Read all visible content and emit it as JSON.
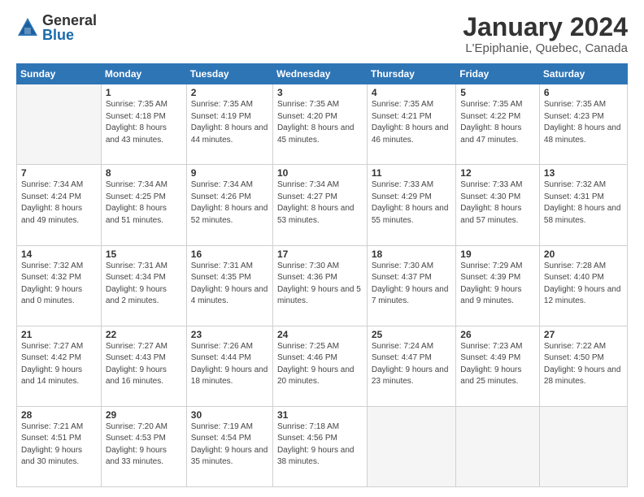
{
  "header": {
    "logo_general": "General",
    "logo_blue": "Blue",
    "title": "January 2024",
    "subtitle": "L'Epiphanie, Quebec, Canada"
  },
  "days": [
    "Sunday",
    "Monday",
    "Tuesday",
    "Wednesday",
    "Thursday",
    "Friday",
    "Saturday"
  ],
  "weeks": [
    [
      {
        "num": "",
        "sunrise": "",
        "sunset": "",
        "daylight": ""
      },
      {
        "num": "1",
        "sunrise": "Sunrise: 7:35 AM",
        "sunset": "Sunset: 4:18 PM",
        "daylight": "Daylight: 8 hours and 43 minutes."
      },
      {
        "num": "2",
        "sunrise": "Sunrise: 7:35 AM",
        "sunset": "Sunset: 4:19 PM",
        "daylight": "Daylight: 8 hours and 44 minutes."
      },
      {
        "num": "3",
        "sunrise": "Sunrise: 7:35 AM",
        "sunset": "Sunset: 4:20 PM",
        "daylight": "Daylight: 8 hours and 45 minutes."
      },
      {
        "num": "4",
        "sunrise": "Sunrise: 7:35 AM",
        "sunset": "Sunset: 4:21 PM",
        "daylight": "Daylight: 8 hours and 46 minutes."
      },
      {
        "num": "5",
        "sunrise": "Sunrise: 7:35 AM",
        "sunset": "Sunset: 4:22 PM",
        "daylight": "Daylight: 8 hours and 47 minutes."
      },
      {
        "num": "6",
        "sunrise": "Sunrise: 7:35 AM",
        "sunset": "Sunset: 4:23 PM",
        "daylight": "Daylight: 8 hours and 48 minutes."
      }
    ],
    [
      {
        "num": "7",
        "sunrise": "Sunrise: 7:34 AM",
        "sunset": "Sunset: 4:24 PM",
        "daylight": "Daylight: 8 hours and 49 minutes."
      },
      {
        "num": "8",
        "sunrise": "Sunrise: 7:34 AM",
        "sunset": "Sunset: 4:25 PM",
        "daylight": "Daylight: 8 hours and 51 minutes."
      },
      {
        "num": "9",
        "sunrise": "Sunrise: 7:34 AM",
        "sunset": "Sunset: 4:26 PM",
        "daylight": "Daylight: 8 hours and 52 minutes."
      },
      {
        "num": "10",
        "sunrise": "Sunrise: 7:34 AM",
        "sunset": "Sunset: 4:27 PM",
        "daylight": "Daylight: 8 hours and 53 minutes."
      },
      {
        "num": "11",
        "sunrise": "Sunrise: 7:33 AM",
        "sunset": "Sunset: 4:29 PM",
        "daylight": "Daylight: 8 hours and 55 minutes."
      },
      {
        "num": "12",
        "sunrise": "Sunrise: 7:33 AM",
        "sunset": "Sunset: 4:30 PM",
        "daylight": "Daylight: 8 hours and 57 minutes."
      },
      {
        "num": "13",
        "sunrise": "Sunrise: 7:32 AM",
        "sunset": "Sunset: 4:31 PM",
        "daylight": "Daylight: 8 hours and 58 minutes."
      }
    ],
    [
      {
        "num": "14",
        "sunrise": "Sunrise: 7:32 AM",
        "sunset": "Sunset: 4:32 PM",
        "daylight": "Daylight: 9 hours and 0 minutes."
      },
      {
        "num": "15",
        "sunrise": "Sunrise: 7:31 AM",
        "sunset": "Sunset: 4:34 PM",
        "daylight": "Daylight: 9 hours and 2 minutes."
      },
      {
        "num": "16",
        "sunrise": "Sunrise: 7:31 AM",
        "sunset": "Sunset: 4:35 PM",
        "daylight": "Daylight: 9 hours and 4 minutes."
      },
      {
        "num": "17",
        "sunrise": "Sunrise: 7:30 AM",
        "sunset": "Sunset: 4:36 PM",
        "daylight": "Daylight: 9 hours and 5 minutes."
      },
      {
        "num": "18",
        "sunrise": "Sunrise: 7:30 AM",
        "sunset": "Sunset: 4:37 PM",
        "daylight": "Daylight: 9 hours and 7 minutes."
      },
      {
        "num": "19",
        "sunrise": "Sunrise: 7:29 AM",
        "sunset": "Sunset: 4:39 PM",
        "daylight": "Daylight: 9 hours and 9 minutes."
      },
      {
        "num": "20",
        "sunrise": "Sunrise: 7:28 AM",
        "sunset": "Sunset: 4:40 PM",
        "daylight": "Daylight: 9 hours and 12 minutes."
      }
    ],
    [
      {
        "num": "21",
        "sunrise": "Sunrise: 7:27 AM",
        "sunset": "Sunset: 4:42 PM",
        "daylight": "Daylight: 9 hours and 14 minutes."
      },
      {
        "num": "22",
        "sunrise": "Sunrise: 7:27 AM",
        "sunset": "Sunset: 4:43 PM",
        "daylight": "Daylight: 9 hours and 16 minutes."
      },
      {
        "num": "23",
        "sunrise": "Sunrise: 7:26 AM",
        "sunset": "Sunset: 4:44 PM",
        "daylight": "Daylight: 9 hours and 18 minutes."
      },
      {
        "num": "24",
        "sunrise": "Sunrise: 7:25 AM",
        "sunset": "Sunset: 4:46 PM",
        "daylight": "Daylight: 9 hours and 20 minutes."
      },
      {
        "num": "25",
        "sunrise": "Sunrise: 7:24 AM",
        "sunset": "Sunset: 4:47 PM",
        "daylight": "Daylight: 9 hours and 23 minutes."
      },
      {
        "num": "26",
        "sunrise": "Sunrise: 7:23 AM",
        "sunset": "Sunset: 4:49 PM",
        "daylight": "Daylight: 9 hours and 25 minutes."
      },
      {
        "num": "27",
        "sunrise": "Sunrise: 7:22 AM",
        "sunset": "Sunset: 4:50 PM",
        "daylight": "Daylight: 9 hours and 28 minutes."
      }
    ],
    [
      {
        "num": "28",
        "sunrise": "Sunrise: 7:21 AM",
        "sunset": "Sunset: 4:51 PM",
        "daylight": "Daylight: 9 hours and 30 minutes."
      },
      {
        "num": "29",
        "sunrise": "Sunrise: 7:20 AM",
        "sunset": "Sunset: 4:53 PM",
        "daylight": "Daylight: 9 hours and 33 minutes."
      },
      {
        "num": "30",
        "sunrise": "Sunrise: 7:19 AM",
        "sunset": "Sunset: 4:54 PM",
        "daylight": "Daylight: 9 hours and 35 minutes."
      },
      {
        "num": "31",
        "sunrise": "Sunrise: 7:18 AM",
        "sunset": "Sunset: 4:56 PM",
        "daylight": "Daylight: 9 hours and 38 minutes."
      },
      {
        "num": "",
        "sunrise": "",
        "sunset": "",
        "daylight": ""
      },
      {
        "num": "",
        "sunrise": "",
        "sunset": "",
        "daylight": ""
      },
      {
        "num": "",
        "sunrise": "",
        "sunset": "",
        "daylight": ""
      }
    ]
  ]
}
